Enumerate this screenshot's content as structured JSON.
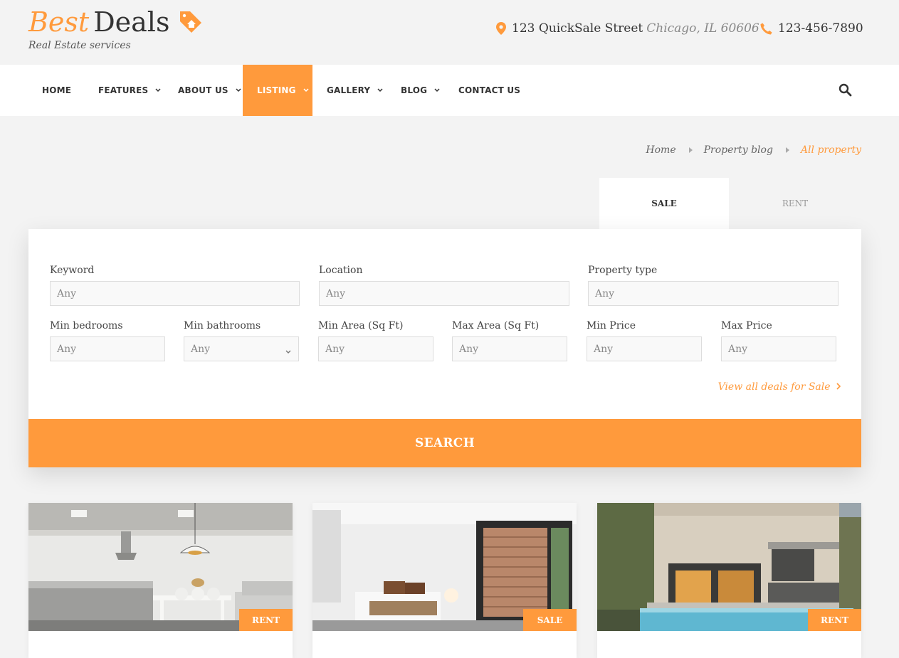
{
  "brand": {
    "best": "Best",
    "deals": "Deals",
    "tagline": "Real Estate services"
  },
  "contact": {
    "street": "123 QuickSale Street",
    "city": "Chicago, IL 60606",
    "phone": "123-456-7890"
  },
  "nav": {
    "items": [
      {
        "label": "HOME"
      },
      {
        "label": "FEATURES"
      },
      {
        "label": "ABOUT US"
      },
      {
        "label": "LISTING"
      },
      {
        "label": "GALLERY"
      },
      {
        "label": "BLOG"
      },
      {
        "label": "CONTACT US"
      }
    ],
    "active": "LISTING"
  },
  "breadcrumb": {
    "home": "Home",
    "blog": "Property blog",
    "current": "All property"
  },
  "tabs": {
    "sale": "SALE",
    "rent": "RENT"
  },
  "search": {
    "keyword_label": "Keyword",
    "keyword_placeholder": "Any",
    "location_label": "Location",
    "location_placeholder": "Any",
    "type_label": "Property type",
    "type_placeholder": "Any",
    "bedrooms_label": "Min bedrooms",
    "bedrooms_placeholder": "Any",
    "bathrooms_label": "Min bathrooms",
    "bathrooms_value": "Any",
    "min_area_label": "Min Area (Sq Ft)",
    "min_area_placeholder": "Any",
    "max_area_label": "Max Area (Sq Ft)",
    "max_area_placeholder": "Any",
    "min_price_label": "Min Price",
    "min_price_placeholder": "Any",
    "max_price_label": "Max Price",
    "max_price_placeholder": "Any",
    "view_all": "View all deals for Sale",
    "submit": "SEARCH"
  },
  "listings": [
    {
      "badge": "RENT",
      "image": "modern-kitchen-dining"
    },
    {
      "badge": "SALE",
      "image": "white-bedroom"
    },
    {
      "badge": "RENT",
      "image": "house-with-pool"
    }
  ],
  "colors": {
    "accent": "#ff9a3c",
    "background": "#f3f3f3"
  }
}
